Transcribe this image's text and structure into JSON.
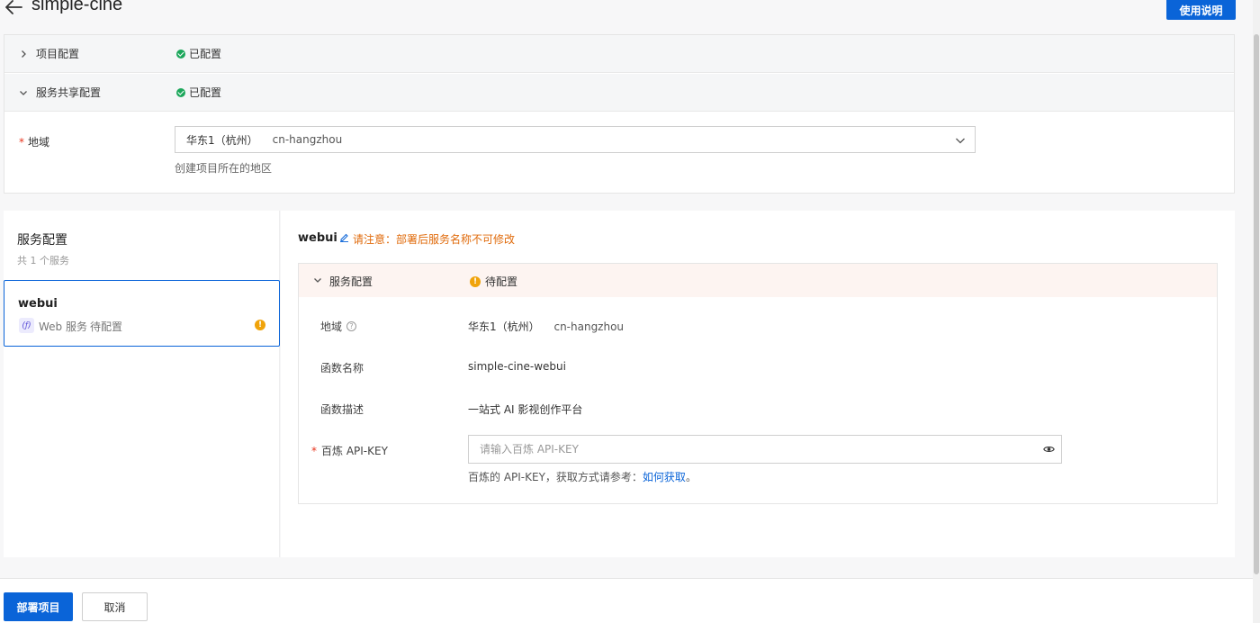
{
  "header": {
    "title": "simple-cine",
    "doc_button": "使用说明"
  },
  "project_section": {
    "row1_label": "项目配置",
    "row1_status": "已配置",
    "row2_label": "服务共享配置",
    "row2_status": "已配置",
    "region_label": "地域",
    "region_value": "华东1（杭州）",
    "region_code": "cn-hangzhou",
    "region_hint": "创建项目所在的地区"
  },
  "services_list": {
    "title": "服务配置",
    "count": "共 1 个服务",
    "items": [
      {
        "name": "webui",
        "type": "Web 服务",
        "state": "待配置"
      }
    ]
  },
  "service_detail": {
    "name": "webui",
    "notice": "请注意：部署后服务名称不可修改",
    "section_label": "服务配置",
    "section_status": "待配置",
    "fields": {
      "region_label": "地域",
      "region_value": "华东1（杭州）",
      "region_code": "cn-hangzhou",
      "function_name_label": "函数名称",
      "function_name_value": "simple-cine-webui",
      "function_desc_label": "函数描述",
      "function_desc_value": "一站式 AI 影视创作平台",
      "apikey_label": "百炼 API-KEY",
      "apikey_placeholder": "请输入百炼 API-KEY",
      "apikey_hint_prefix": "百炼的 API-KEY，获取方式请参考：",
      "apikey_hint_link": "如何获取",
      "apikey_hint_suffix": "。"
    }
  },
  "footer": {
    "deploy_button": "部署项目",
    "cancel_button": "取消"
  },
  "colors": {
    "primary": "#0a64d8",
    "success": "#1ca75b",
    "warning": "#f0a30a",
    "notice": "#e06b0c"
  }
}
